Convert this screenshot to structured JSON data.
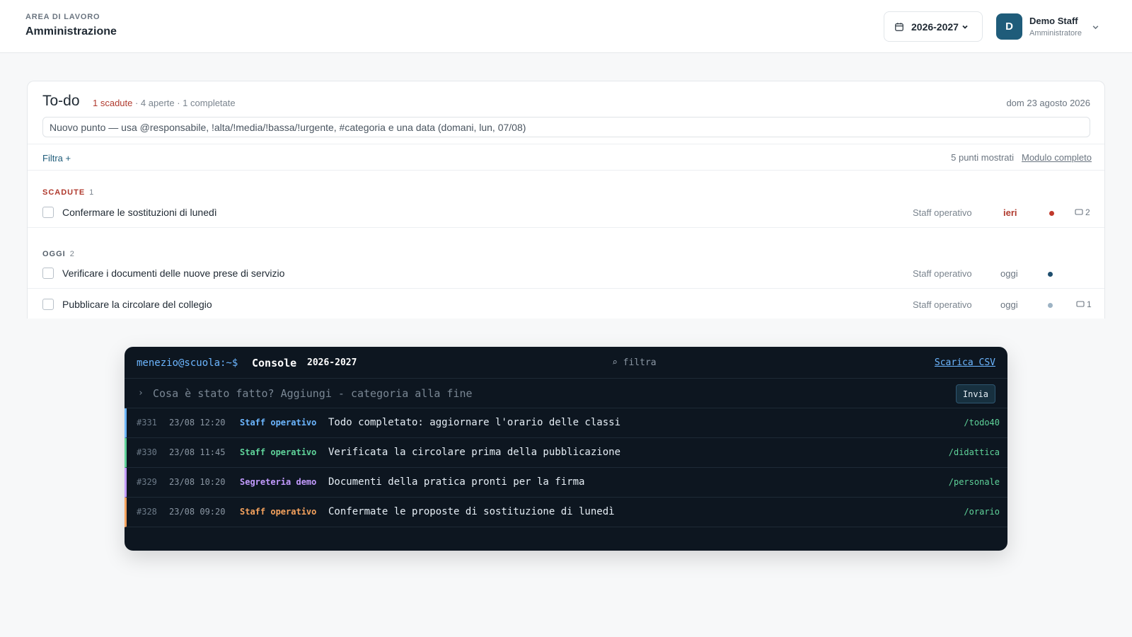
{
  "header": {
    "kicker": "AREA DI LAVORO",
    "title": "Amministrazione",
    "year": "2026-2027",
    "user": {
      "initial": "D",
      "name": "Demo Staff",
      "role": "Amministratore"
    }
  },
  "todo": {
    "title": "To-do",
    "summary_overdue": "1 scadute",
    "summary_rest": " · 4 aperte · 1 completate",
    "date": "dom 23 agosto 2026",
    "input_placeholder": "Nuovo punto — usa @responsabile, !alta/!media/!bassa/!urgente, #categoria e una data (domani, lun, 07/08)",
    "filter_label": "Filtra +",
    "shown_count": "5 punti mostrati",
    "module_link": "Modulo completo",
    "sections": [
      {
        "label": "SCADUTE",
        "count": "1",
        "items": [
          {
            "text": "Confermare le sostituzioni di lunedì",
            "owner": "Staff operativo",
            "due": "ieri",
            "priority_color": "#c0392b",
            "comments": "2"
          }
        ]
      },
      {
        "label": "OGGI",
        "count": "2",
        "items": [
          {
            "text": "Verificare i documenti delle nuove prese di servizio",
            "owner": "Staff operativo",
            "due": "oggi",
            "priority_color": "#1f4e6e",
            "comments": ""
          },
          {
            "text": "Pubblicare la circolare del collegio",
            "owner": "Staff operativo",
            "due": "oggi",
            "priority_color": "#9db3c4",
            "comments": "1"
          }
        ]
      }
    ]
  },
  "console": {
    "prompt": "menezio@scuola:~$",
    "title": "Console",
    "year": "2026-2027",
    "filter_placeholder": "⌕ filtra",
    "csv_link": "Scarica CSV",
    "caret": "›",
    "input_placeholder": "Cosa è stato fatto? Aggiungi - categoria alla fine",
    "send_label": "Invia",
    "entries": [
      {
        "id": "#331",
        "ts": "23/08 12:20",
        "user": "Staff operativo",
        "msg": "Todo completato: aggiornare l'orario delle classi",
        "tag": "/todo40",
        "color": "#6cb6ff"
      },
      {
        "id": "#330",
        "ts": "23/08 11:45",
        "user": "Staff operativo",
        "msg": "Verificata la circolare prima della pubblicazione",
        "tag": "/didattica",
        "color": "#5fd39a"
      },
      {
        "id": "#329",
        "ts": "23/08 10:20",
        "user": "Segreteria demo",
        "msg": "Documenti della pratica pronti per la firma",
        "tag": "/personale",
        "color": "#c39bff"
      },
      {
        "id": "#328",
        "ts": "23/08 09:20",
        "user": "Staff operativo",
        "msg": "Confermate le proposte di sostituzione di lunedì",
        "tag": "/orario",
        "color": "#f5a25d"
      }
    ]
  },
  "icons": [
    "calendar-icon",
    "chevron-down-icon",
    "comment-icon"
  ]
}
